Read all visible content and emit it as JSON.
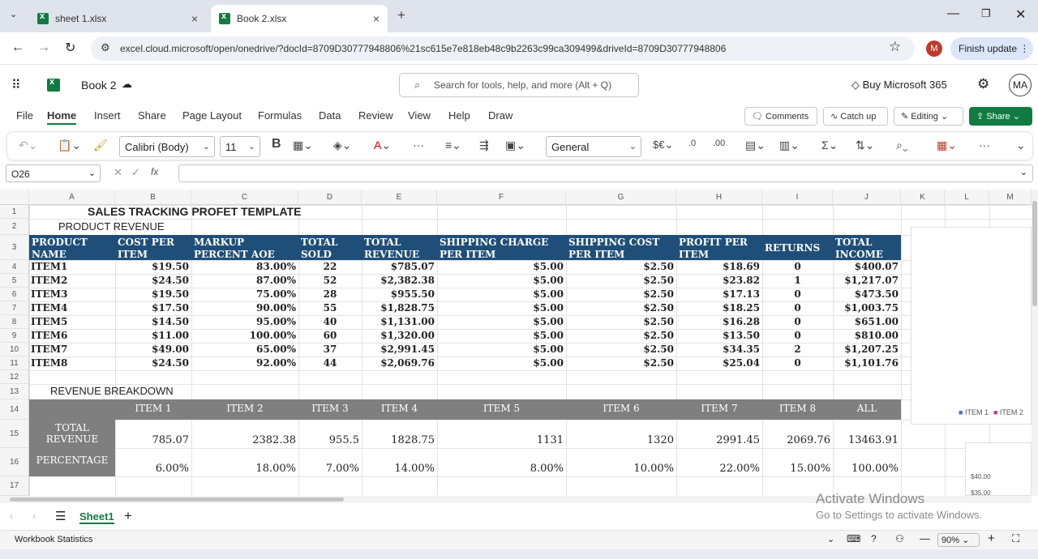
{
  "browser": {
    "tabs": [
      {
        "label": "sheet 1.xlsx"
      },
      {
        "label": "Book 2.xlsx"
      }
    ],
    "url": "excel.cloud.microsoft/open/onedrive/?docId=8709D30777948806%21sc615e7e818eb48c9b2263c99ca309499&driveId=8709D30777948806",
    "profile": "M",
    "finish_update": "Finish update"
  },
  "app": {
    "doc_title": "Book 2",
    "search_placeholder": "Search for tools, help, and more (Alt + Q)",
    "buy": "Buy Microsoft 365",
    "user": "MA"
  },
  "menu": {
    "items": [
      "File",
      "Home",
      "Insert",
      "Share",
      "Page Layout",
      "Formulas",
      "Data",
      "Review",
      "View",
      "Help",
      "Draw"
    ],
    "comments": "Comments",
    "catchup": "Catch up",
    "editing": "Editing",
    "share": "Share"
  },
  "ribbon": {
    "font": "Calibri (Body)",
    "size": "11",
    "format": "General"
  },
  "formula": {
    "namebox": "O26"
  },
  "columns": [
    "A",
    "B",
    "C",
    "D",
    "E",
    "F",
    "G",
    "H",
    "I",
    "J",
    "K",
    "L",
    "M"
  ],
  "rows": [
    "1",
    "2",
    "3",
    "4",
    "5",
    "6",
    "7",
    "8",
    "9",
    "10",
    "11",
    "12",
    "13",
    "14",
    "15",
    "16",
    "17"
  ],
  "sheet": {
    "title": "SALES TRACKING PROFET TEMPLATE",
    "section1": "PRODUCT REVENUE",
    "headers": [
      "PRODUCT NAME",
      "COST PER ITEM",
      "MARKUP PERCENT AOE",
      "TOTAL SOLD",
      "TOTAL REVENUE",
      "SHIPPING CHARGE PER ITEM",
      "SHIPPING COST PER ITEM",
      "PROFIT PER ITEM",
      "RETURNS",
      "TOTAL INCOME"
    ],
    "items": [
      [
        "ITEM1",
        "$19.50",
        "83.00%",
        "22",
        "$785.07",
        "$5.00",
        "$2.50",
        "$18.69",
        "0",
        "$400.07"
      ],
      [
        "ITEM2",
        "$24.50",
        "87.00%",
        "52",
        "$2,382.38",
        "$5.00",
        "$2.50",
        "$23.82",
        "1",
        "$1,217.07"
      ],
      [
        "ITEM3",
        "$19.50",
        "75.00%",
        "28",
        "$955.50",
        "$5.00",
        "$2.50",
        "$17.13",
        "0",
        "$473.50"
      ],
      [
        "ITEM4",
        "$17.50",
        "90.00%",
        "55",
        "$1,828.75",
        "$5.00",
        "$2.50",
        "$18.25",
        "0",
        "$1,003.75"
      ],
      [
        "ITEM5",
        "$14.50",
        "95.00%",
        "40",
        "$1,131.00",
        "$5.00",
        "$2.50",
        "$16.28",
        "0",
        "$651.00"
      ],
      [
        "ITEM6",
        "$11.00",
        "100.00%",
        "60",
        "$1,320.00",
        "$5.00",
        "$2.50",
        "$13.50",
        "0",
        "$810.00"
      ],
      [
        "ITEM7",
        "$49.00",
        "65.00%",
        "37",
        "$2,991.45",
        "$5.00",
        "$2.50",
        "$34.35",
        "2",
        "$1,207.25"
      ],
      [
        "ITEM8",
        "$24.50",
        "92.00%",
        "44",
        "$2,069.76",
        "$5.00",
        "$2.50",
        "$25.04",
        "0",
        "$1,101.76"
      ]
    ],
    "section2": "REVENUE BREAKDOWN",
    "bk_headers": [
      "ITEM 1",
      "ITEM 2",
      "ITEM 3",
      "ITEM 4",
      "ITEM 5",
      "ITEM 6",
      "ITEM 7",
      "ITEM 8",
      "ALL"
    ],
    "bk_labels": [
      "TOTAL REVENUE",
      "PERCENTAGE"
    ],
    "bk_rev": [
      "785.07",
      "2382.38",
      "955.5",
      "1828.75",
      "1131",
      "1320",
      "2991.45",
      "2069.76",
      "13463.91"
    ],
    "bk_pct": [
      "6.00%",
      "18.00%",
      "7.00%",
      "14.00%",
      "8.00%",
      "10.00%",
      "22.00%",
      "15.00%",
      "100.00%"
    ]
  },
  "chart": {
    "legend": [
      "ITEM 1",
      "ITEM 2"
    ],
    "ticks": [
      "$40.00",
      "$35.00"
    ]
  },
  "sheet_tab": "Sheet1",
  "watermark": {
    "line1": "Activate Windows",
    "line2": "Go to Settings to activate Windows."
  },
  "status": {
    "left": "Workbook Statistics",
    "zoom": "90%"
  },
  "colors": {
    "header_blue": "#1f4e79",
    "gray": "#7f7f7f",
    "excel_green": "#107c41"
  }
}
